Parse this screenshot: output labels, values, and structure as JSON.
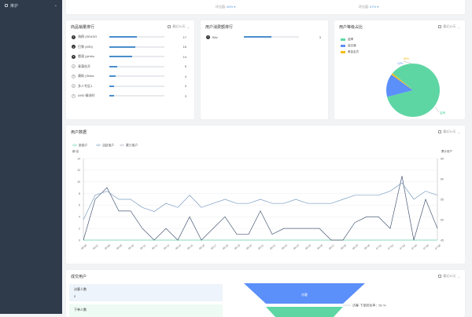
{
  "sidebar": {
    "items": [
      {
        "label": "推护",
        "icon": "dashboard-icon"
      }
    ]
  },
  "top_card": {
    "stats": [
      {
        "label": "环比值",
        "value": "60% ▾"
      },
      {
        "label": "环比值",
        "value": "67% ▾"
      }
    ]
  },
  "product_rank": {
    "title": "商品销量排行",
    "control": "最近30天",
    "items": [
      {
        "rank": "1",
        "name": "海鸥 (SEASO",
        "value": 17,
        "value_text": "17"
      },
      {
        "rank": "2",
        "name": "巴黎 (MSI)",
        "value": 16,
        "value_text": "16"
      },
      {
        "rank": "3",
        "name": "雷速 (yimbo",
        "value": 14,
        "value_text": "14"
      },
      {
        "rank": "4",
        "name": "青蒲花开",
        "value": 5,
        "value_text": "5"
      },
      {
        "rank": "5",
        "name": "康助 (Shika",
        "value": 4,
        "value_text": "4"
      },
      {
        "rank": "6",
        "name": "多人专区4",
        "value": 3,
        "value_text": "3"
      },
      {
        "rank": "7",
        "name": "AHD 精选时",
        "value": 3,
        "value_text": "3"
      }
    ],
    "max": 17
  },
  "user_rank": {
    "title": "用户消费额排行",
    "items": [
      {
        "rank": "1",
        "name": "Bbz",
        "value": 3,
        "value_text": "3"
      }
    ],
    "max": 3
  },
  "user_level": {
    "title": "用户等级占比",
    "control": "最近30天",
    "legend": [
      {
        "label": "金牌",
        "color": "#5ed6a4"
      },
      {
        "label": "金店通",
        "color": "#5b8ff9"
      },
      {
        "label": "黄金会员",
        "color": "#f6bd16"
      }
    ],
    "slices": [
      {
        "label": "金牌",
        "value": 85,
        "color": "#5ed6a4"
      },
      {
        "label": "金店通",
        "value": 14,
        "color": "#5b8ff9"
      },
      {
        "label": "黄金会员",
        "value": 1,
        "color": "#f6bd16"
      }
    ],
    "slice_labels": [
      "88%",
      "12%",
      "金牌"
    ]
  },
  "user_data": {
    "title": "用户数据",
    "control": "最近30天",
    "legend": [
      {
        "label": "新用户"
      },
      {
        "label": "活跃用户"
      },
      {
        "label": "累计用户"
      }
    ],
    "left_axis_title": "新/活",
    "right_axis_title": "累计用户"
  },
  "funnel": {
    "title": "成交用户",
    "control": "最近30天",
    "rows": [
      {
        "label": "访客人数",
        "value": "2"
      },
      {
        "label": "下单人数",
        "value": ""
      }
    ],
    "bars": [
      {
        "label": "访客"
      }
    ],
    "rate": "访客-下单转化率：50 %"
  },
  "chart_data": {
    "type": "line",
    "x": [
      "06-06",
      "06-07",
      "06-08",
      "06-09",
      "06-10",
      "06-11",
      "06-12",
      "06-13",
      "06-14",
      "06-15",
      "06-16",
      "06-17",
      "06-18",
      "06-19",
      "06-20",
      "06-21",
      "06-22",
      "06-23",
      "06-24",
      "06-25",
      "06-26",
      "06-27",
      "06-28",
      "06-29",
      "06-30",
      "07-01",
      "07-02",
      "07-03",
      "07-04",
      "07-05",
      "07-06"
    ],
    "ylim_left": [
      0,
      14
    ],
    "yticks_left": [
      0,
      2,
      4,
      6,
      8,
      10,
      12,
      14
    ],
    "ylim_right": [
      45,
      65
    ],
    "yticks_right": [
      45,
      50,
      55,
      60,
      65
    ],
    "series": [
      {
        "name": "新用户",
        "axis": "left",
        "color": "#5ed6a4",
        "values": [
          0,
          0,
          0,
          0,
          0,
          0,
          0,
          0,
          0,
          0,
          0,
          0,
          0,
          0,
          0,
          0,
          0,
          0,
          0,
          0,
          0,
          0,
          0,
          0,
          0,
          0,
          0,
          0,
          0,
          0,
          0
        ]
      },
      {
        "name": "活跃用户",
        "axis": "left",
        "color": "#4a5a75",
        "values": [
          0,
          7,
          9,
          5,
          5,
          2,
          0,
          2,
          0,
          4,
          0,
          2,
          4,
          1,
          1,
          5,
          1,
          2,
          2,
          2,
          2,
          0,
          0,
          3,
          4,
          4,
          2,
          11,
          0,
          7,
          2
        ]
      },
      {
        "name": "累计用户",
        "axis": "right",
        "color": "#7a9cc0",
        "values": [
          50,
          56,
          57,
          55,
          55,
          53,
          52,
          54,
          53,
          56,
          53,
          54,
          55,
          54,
          54,
          55,
          54,
          54,
          55,
          54,
          54,
          54,
          55,
          56,
          56,
          56,
          57,
          59,
          55,
          57,
          56
        ]
      }
    ],
    "grid": true,
    "legend_position": "top-left"
  }
}
